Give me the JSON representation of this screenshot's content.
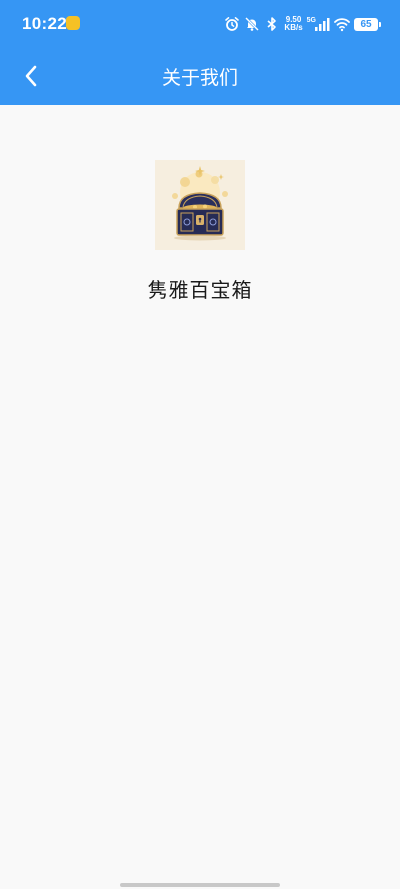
{
  "status_bar": {
    "time": "10:22",
    "net_speed_value": "9.50",
    "net_speed_unit": "KB/s",
    "network_type": "5G",
    "battery_level": "65",
    "icons": [
      "app-notification-icon",
      "alarm-icon",
      "mute-icon",
      "bluetooth-icon",
      "signal-icon",
      "wifi-icon",
      "battery-icon"
    ]
  },
  "header": {
    "title": "关于我们",
    "back_icon": "chevron-left-icon",
    "background_color": "#3696f4"
  },
  "main": {
    "logo_icon": "treasure-chest-logo",
    "app_name": "隽雅百宝箱"
  }
}
